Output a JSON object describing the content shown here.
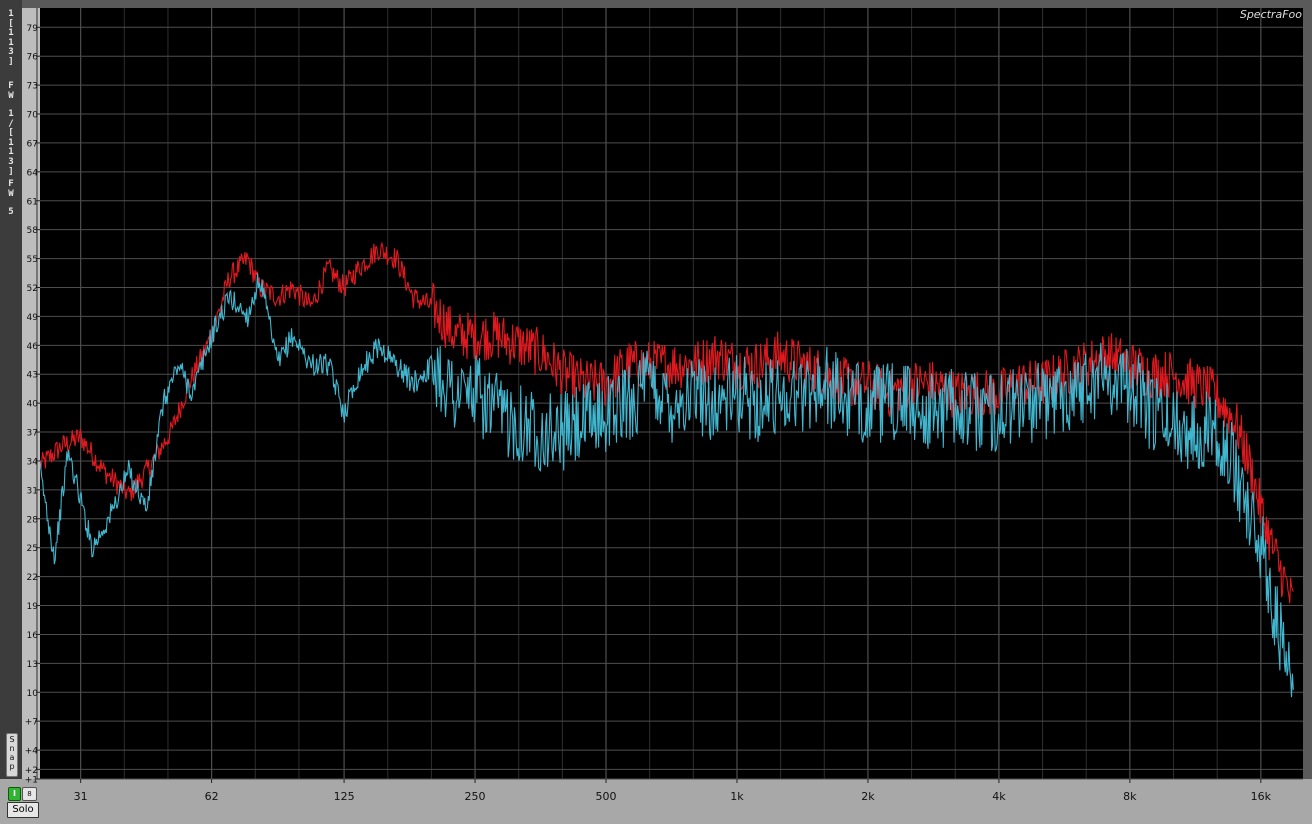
{
  "app": {
    "brand": "SpectraFoo",
    "channel_label_1": "1\n[\n1\n1\n3\n]",
    "channel_label_2": "F\nW",
    "channel_label_3": "1\n/\n[\n1\n1\n3\n]",
    "channel_label_4": "F\nW",
    "channel_label_5": "5",
    "snap_label": "S\nn\na\np",
    "solo_label": "Solo",
    "green_toggle_label": "I",
    "mini_button_label": "8"
  },
  "colors": {
    "background": "#000000",
    "grid": "#4e4e4e",
    "series_red": "#e0191f",
    "series_cyan": "#41b6cf"
  },
  "chart_data": {
    "type": "line",
    "xscale": "log",
    "xlim": [
      25,
      20000
    ],
    "ylim": [
      1,
      81
    ],
    "x_ticks": [
      {
        "v": 31,
        "label": "31"
      },
      {
        "v": 62,
        "label": "62"
      },
      {
        "v": 125,
        "label": "125"
      },
      {
        "v": 250,
        "label": "250"
      },
      {
        "v": 500,
        "label": "500"
      },
      {
        "v": 1000,
        "label": "1k"
      },
      {
        "v": 2000,
        "label": "2k"
      },
      {
        "v": 4000,
        "label": "4k"
      },
      {
        "v": 8000,
        "label": "8k"
      },
      {
        "v": 16000,
        "label": "16k"
      }
    ],
    "y_ticks": [
      {
        "v": 79,
        "label": "79"
      },
      {
        "v": 76,
        "label": "76"
      },
      {
        "v": 73,
        "label": "73"
      },
      {
        "v": 70,
        "label": "70"
      },
      {
        "v": 67,
        "label": "67"
      },
      {
        "v": 64,
        "label": "64"
      },
      {
        "v": 61,
        "label": "61"
      },
      {
        "v": 58,
        "label": "58"
      },
      {
        "v": 55,
        "label": "55"
      },
      {
        "v": 52,
        "label": "52"
      },
      {
        "v": 49,
        "label": "49"
      },
      {
        "v": 46,
        "label": "46"
      },
      {
        "v": 43,
        "label": "43"
      },
      {
        "v": 40,
        "label": "40"
      },
      {
        "v": 37,
        "label": "37"
      },
      {
        "v": 34,
        "label": "34"
      },
      {
        "v": 31,
        "label": "31"
      },
      {
        "v": 28,
        "label": "28"
      },
      {
        "v": 25,
        "label": "25"
      },
      {
        "v": 22,
        "label": "22"
      },
      {
        "v": 19,
        "label": "19"
      },
      {
        "v": 16,
        "label": "16"
      },
      {
        "v": 13,
        "label": "13"
      },
      {
        "v": 10,
        "label": "10"
      },
      {
        "v": 7,
        "label": "+7"
      },
      {
        "v": 4,
        "label": "+4"
      },
      {
        "v": 2,
        "label": "+2"
      },
      {
        "v": 1,
        "label": "+1"
      }
    ],
    "series": [
      {
        "color": "#e0191f",
        "x": [
          25,
          28,
          31,
          35,
          40,
          44,
          50,
          55,
          62,
          68,
          75,
          80,
          88,
          95,
          105,
          115,
          125,
          135,
          150,
          165,
          180,
          200,
          225,
          250,
          280,
          320,
          360,
          400,
          450,
          500,
          560,
          630,
          710,
          800,
          900,
          1000,
          1120,
          1250,
          1400,
          1600,
          1800,
          2000,
          2240,
          2500,
          2800,
          3150,
          3550,
          4000,
          4500,
          5000,
          5600,
          6300,
          7100,
          8000,
          9000,
          10000,
          11200,
          12500,
          14000,
          15000,
          16000,
          17000,
          18000,
          19000
        ],
        "y": [
          33.5,
          35.5,
          36.5,
          33,
          30.5,
          33,
          37,
          42,
          47,
          53,
          55,
          52,
          51,
          52,
          50,
          54,
          52,
          54,
          56,
          55,
          51,
          50,
          47,
          47,
          47,
          46,
          45,
          43,
          42,
          42,
          44,
          44,
          44,
          44,
          45,
          44,
          44,
          45,
          44,
          43,
          42,
          42,
          41,
          42,
          42,
          41,
          41,
          41,
          42,
          42,
          43,
          44,
          45,
          44,
          43,
          43,
          42,
          41,
          38,
          34,
          29,
          25,
          22,
          19
        ]
      },
      {
        "color": "#41b6cf",
        "x": [
          25,
          27,
          29,
          31,
          33,
          36,
          40,
          44,
          48,
          52,
          56,
          62,
          68,
          75,
          80,
          88,
          95,
          105,
          115,
          125,
          135,
          150,
          165,
          180,
          200,
          225,
          250,
          280,
          320,
          360,
          400,
          450,
          500,
          560,
          630,
          710,
          800,
          900,
          1000,
          1120,
          1250,
          1400,
          1600,
          1800,
          2000,
          2240,
          2500,
          2800,
          3150,
          3550,
          4000,
          4500,
          5000,
          5600,
          6300,
          7100,
          8000,
          9000,
          10000,
          11200,
          12500,
          14000,
          15000,
          16000,
          17000,
          18000,
          19000
        ],
        "y": [
          33,
          24,
          35,
          30,
          25,
          28,
          33,
          29,
          40,
          44,
          41,
          47,
          51,
          49,
          53,
          44,
          47,
          44,
          44,
          39,
          43,
          46,
          44,
          42,
          44,
          41,
          41,
          39,
          38,
          37,
          37,
          38,
          39,
          40,
          42,
          40,
          41,
          40,
          41,
          40,
          41,
          41,
          42,
          40,
          40,
          40,
          40,
          39,
          40,
          39,
          39,
          40,
          40,
          41,
          42,
          43,
          42,
          39,
          38,
          37,
          38,
          33,
          29,
          25,
          20,
          14,
          9.5
        ]
      }
    ]
  }
}
